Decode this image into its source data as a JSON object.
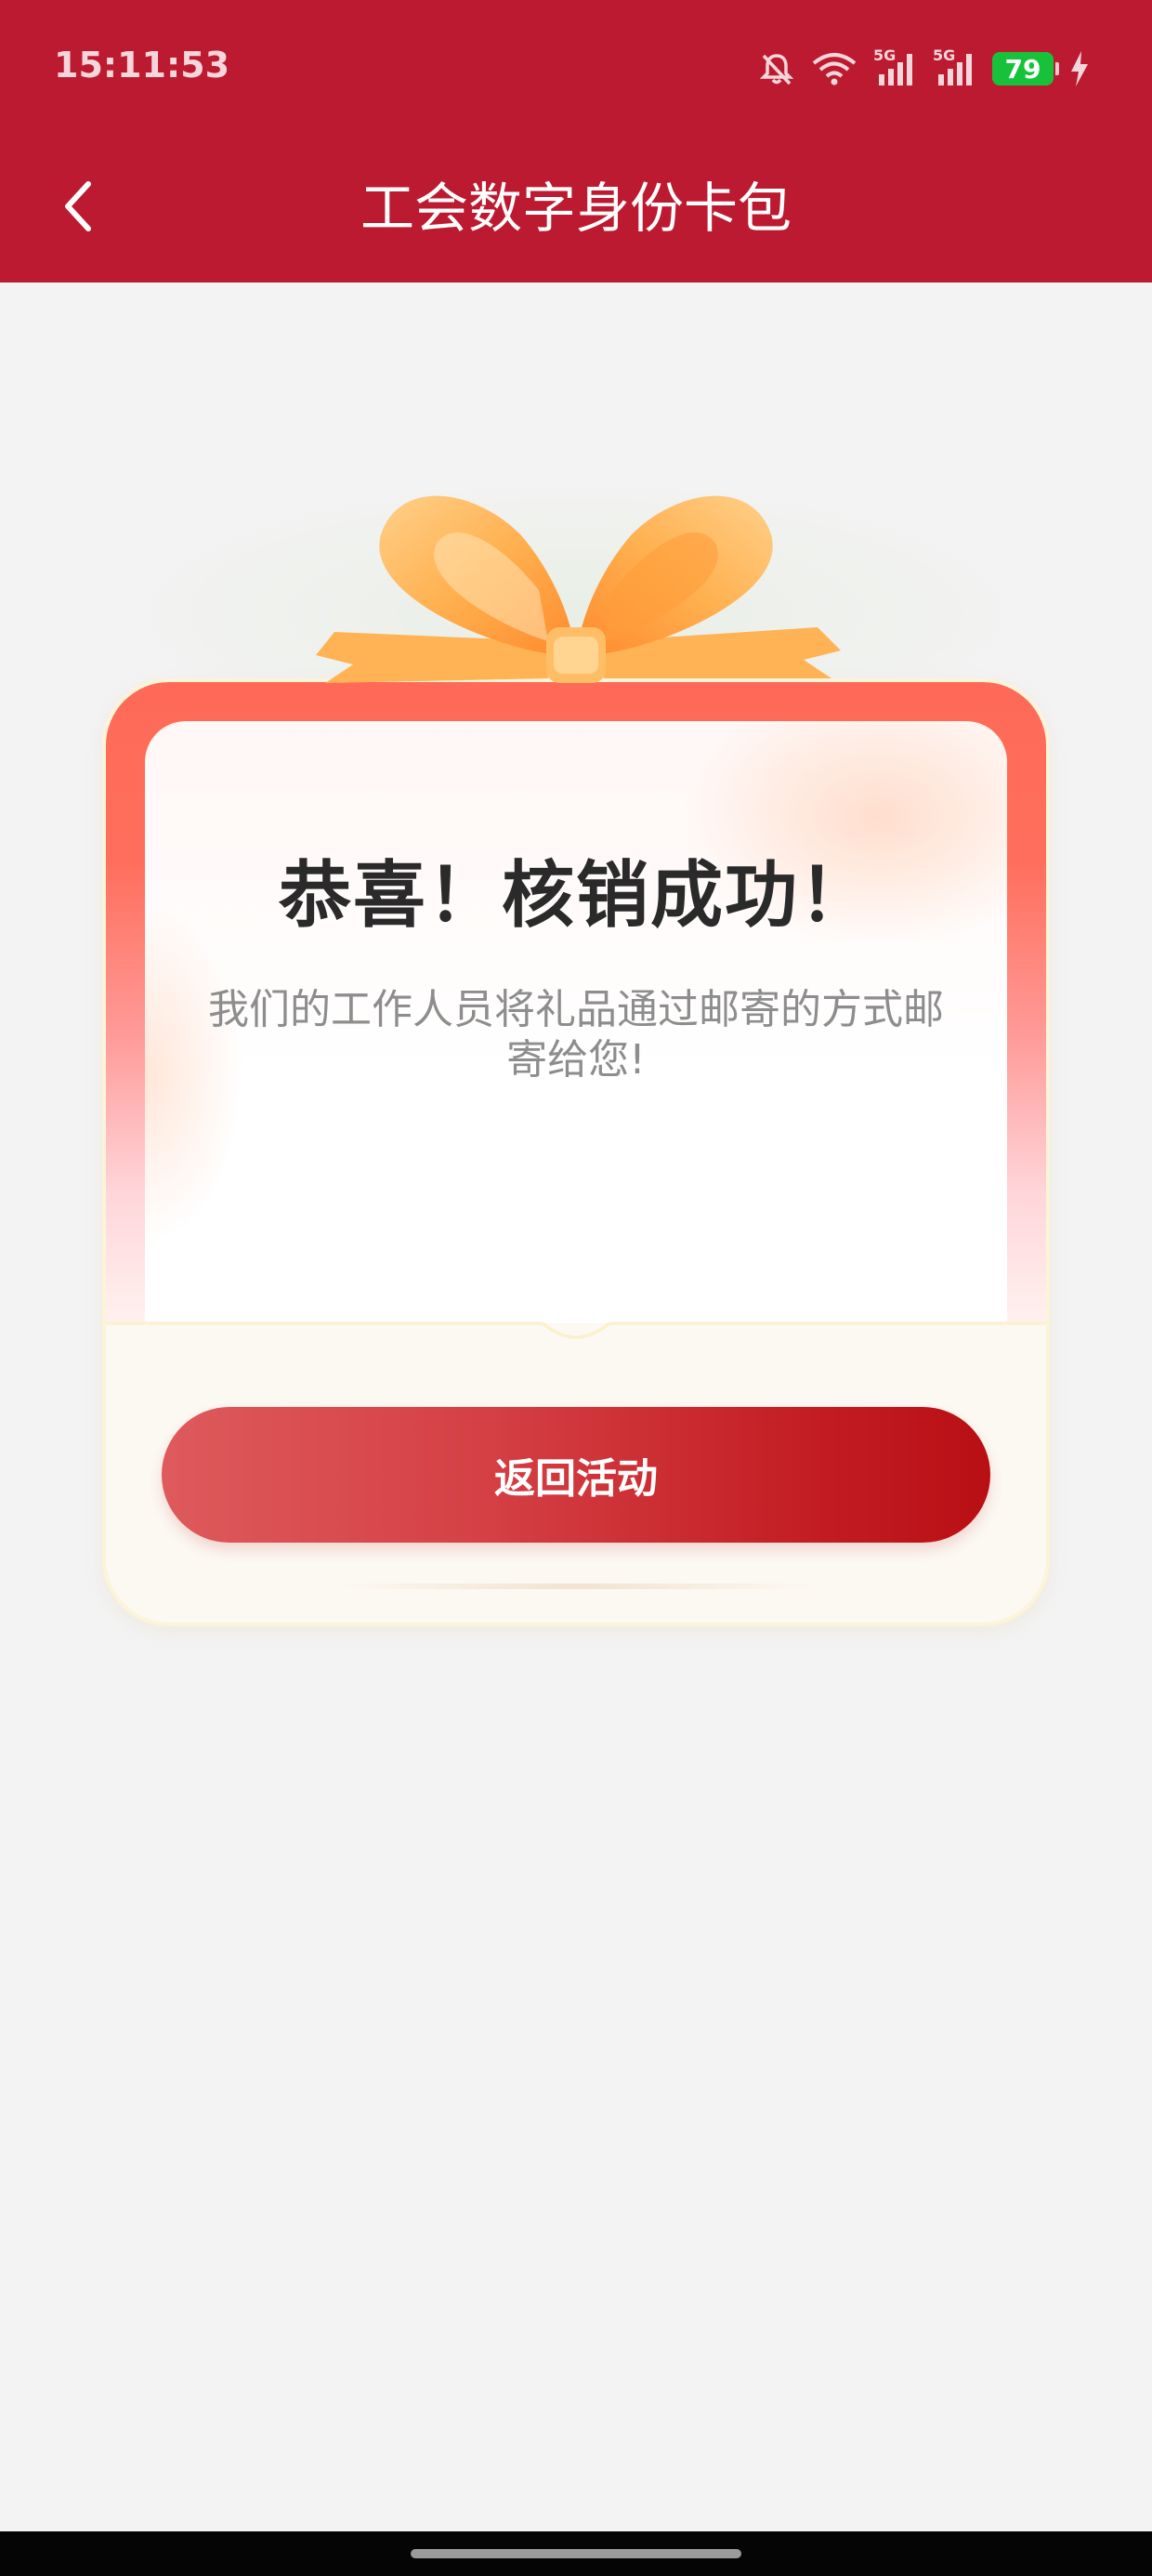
{
  "status_bar": {
    "time": "15:11:53",
    "battery_level": "79",
    "network_label_1": "5G",
    "network_label_2": "5G",
    "icons": [
      "bell-muted-icon",
      "wifi-icon",
      "signal-5g-icon",
      "signal-5g-icon",
      "battery-icon",
      "charging-icon"
    ],
    "battery_color": "#17c23a"
  },
  "header": {
    "title": "工会数字身份卡包",
    "back_icon": "chevron-left-icon",
    "background_color": "#bc1a30"
  },
  "card": {
    "title": "恭喜！核销成功！",
    "message": "我们的工作人员将礼品通过邮寄的方式邮寄给您!",
    "button_label": "返回活动",
    "button_color": "#c21c22",
    "decoration_icon": "gift-ribbon-icon"
  }
}
